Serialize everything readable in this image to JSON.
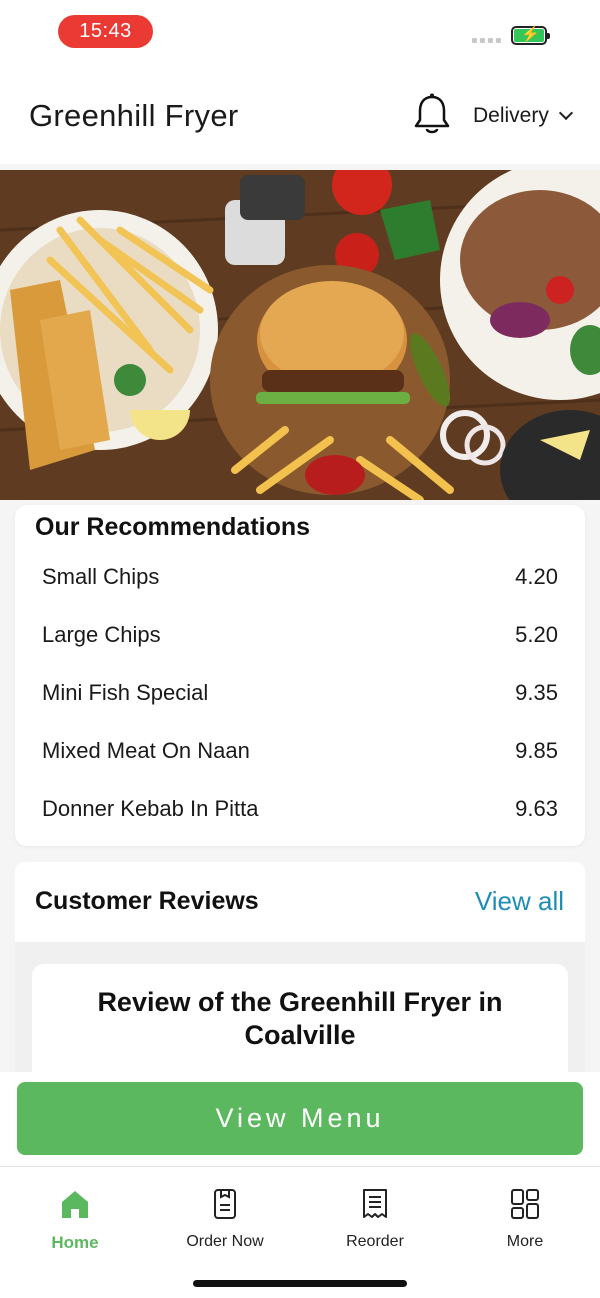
{
  "status_bar": {
    "time": "15:43"
  },
  "header": {
    "title": "Greenhill Fryer",
    "order_mode": "Delivery"
  },
  "hero": {
    "icon": "food-banner-image"
  },
  "recommendations": {
    "title": "Our Recommendations",
    "items": [
      {
        "name": "Small Chips",
        "price": "4.20"
      },
      {
        "name": "Large Chips",
        "price": "5.20"
      },
      {
        "name": "Mini Fish Special",
        "price": "9.35"
      },
      {
        "name": "Mixed Meat On Naan",
        "price": "9.85"
      },
      {
        "name": "Donner Kebab In Pitta",
        "price": "9.63"
      }
    ]
  },
  "reviews": {
    "title": "Customer Reviews",
    "view_all": "View all",
    "card_title": "Review of the Greenhill Fryer in Coalville"
  },
  "cta": {
    "label": "View Menu"
  },
  "nav": {
    "items": [
      {
        "label": "Home",
        "icon": "home-icon",
        "active": true
      },
      {
        "label": "Order Now",
        "icon": "order-icon",
        "active": false
      },
      {
        "label": "Reorder",
        "icon": "receipt-icon",
        "active": false
      },
      {
        "label": "More",
        "icon": "grid-icon",
        "active": false
      }
    ]
  },
  "colors": {
    "accent_green": "#5cb85f",
    "link_blue": "#1e8eb4",
    "time_pill": "#ea3a33"
  }
}
